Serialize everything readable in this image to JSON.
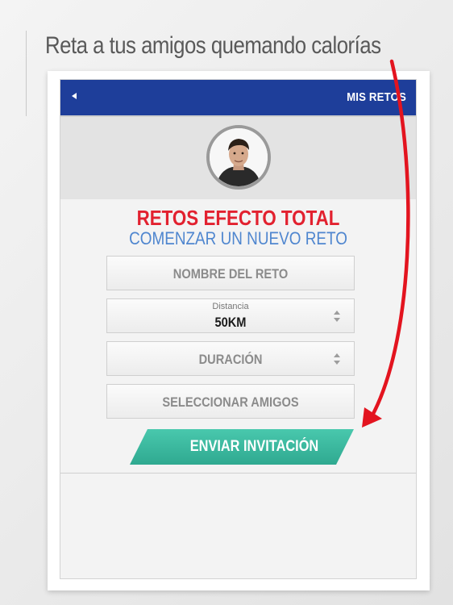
{
  "headline": "Reta a tus amigos quemando calorías",
  "topbar": {
    "back_icon": "back-arrow-icon",
    "title": "MIS RETOS"
  },
  "challenge": {
    "title": "RETOS EFECTO TOTAL",
    "subtitle": "COMENZAR UN NUEVO RETO"
  },
  "form": {
    "name_placeholder": "NOMBRE DEL RETO",
    "distance": {
      "label": "Distancia",
      "value": "50KM",
      "icon": "stepper-icon"
    },
    "duration": {
      "placeholder": "DURACIÓN",
      "icon": "stepper-icon"
    },
    "friends_placeholder": "SELECCIONAR AMIGOS",
    "submit_label": "ENVIAR INVITACIÓN"
  },
  "colors": {
    "brand_blue": "#1e3e9a",
    "title_red": "#e2212f",
    "subtitle_blue": "#4f86cf",
    "button_teal": "#38b9a0",
    "annotation_red": "#e3141f"
  }
}
